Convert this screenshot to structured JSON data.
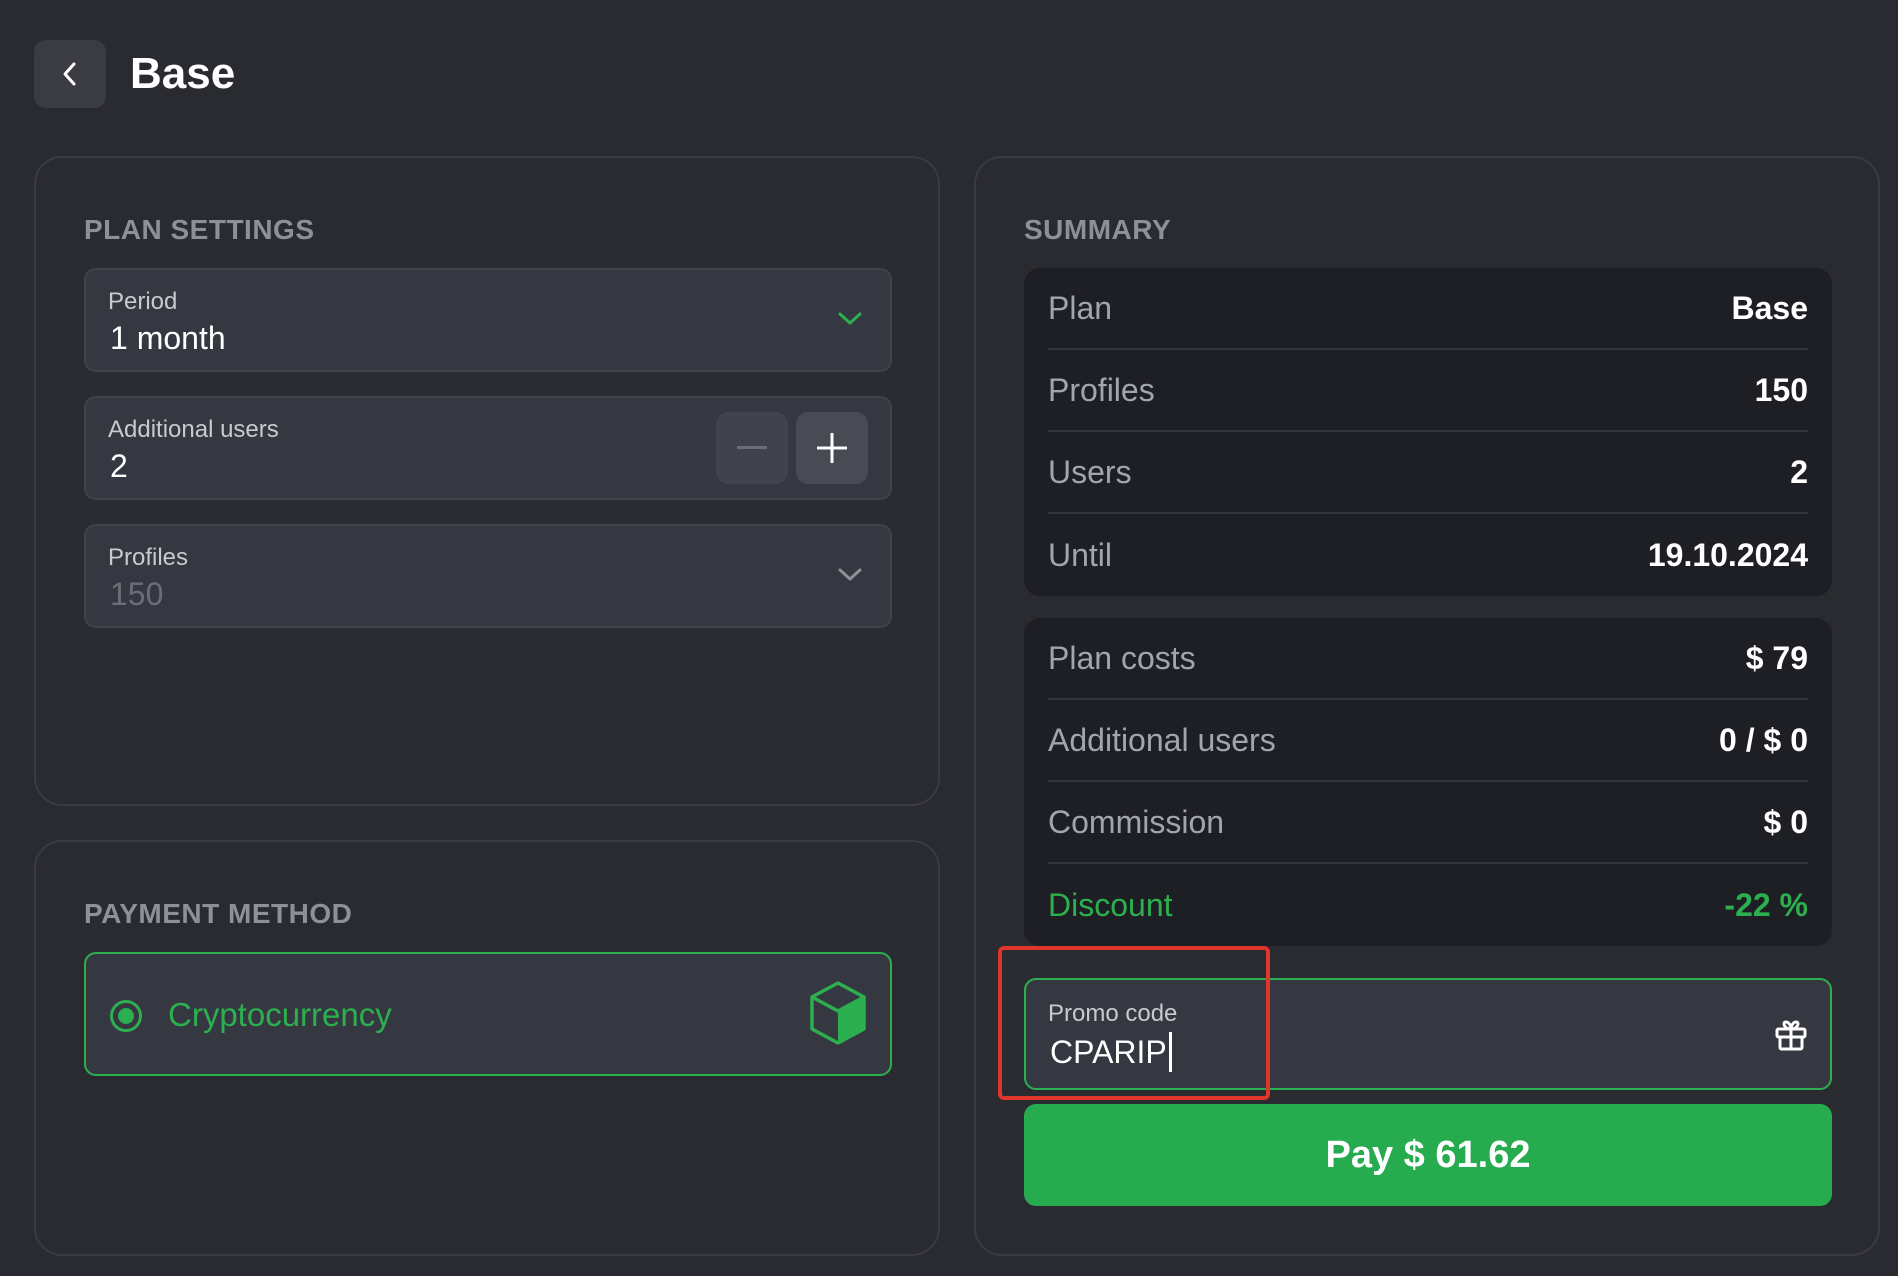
{
  "header": {
    "title": "Base",
    "back_icon": "chevron-left-icon"
  },
  "plan_settings": {
    "heading": "PLAN SETTINGS",
    "period": {
      "label": "Period",
      "value": "1 month",
      "icon": "chevron-down-icon"
    },
    "additional_users": {
      "label": "Additional users",
      "value": "2",
      "minus_icon": "minus-icon",
      "plus_icon": "plus-icon"
    },
    "profiles": {
      "label": "Profiles",
      "value": "150",
      "icon": "chevron-down-icon"
    }
  },
  "payment_method": {
    "heading": "PAYMENT METHOD",
    "selected": {
      "label": "Cryptocurrency",
      "icon": "cube-icon",
      "checked": true
    }
  },
  "summary": {
    "heading": "SUMMARY",
    "plan_rows": [
      {
        "label": "Plan",
        "value": "Base"
      },
      {
        "label": "Profiles",
        "value": "150"
      },
      {
        "label": "Users",
        "value": "2"
      },
      {
        "label": "Until",
        "value": "19.10.2024"
      }
    ],
    "cost_rows": [
      {
        "label": "Plan costs",
        "value": "$ 79"
      },
      {
        "label": "Additional users",
        "value": "0 / $ 0"
      },
      {
        "label": "Commission",
        "value": "$ 0"
      },
      {
        "label": "Discount",
        "value": "-22 %"
      }
    ],
    "promo": {
      "label": "Promo code",
      "value": "CPARIP",
      "icon": "gift-icon"
    },
    "pay_button": "Pay $ 61.62"
  },
  "colors": {
    "background": "#2a2b31",
    "accent": "#2cb04f",
    "highlight": "#e0352b"
  }
}
